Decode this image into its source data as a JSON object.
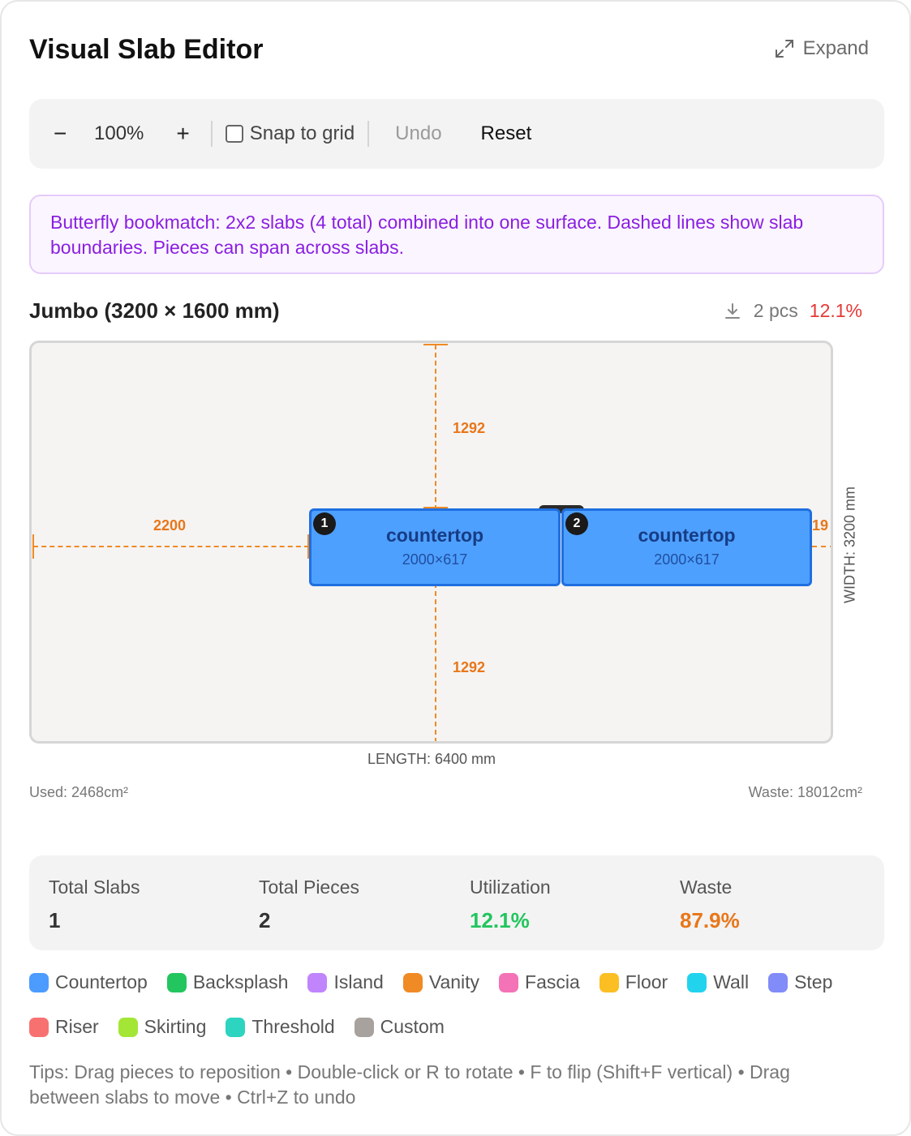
{
  "header": {
    "title": "Visual Slab Editor",
    "expand_label": "Expand",
    "expand_icon": "expand-arrows-icon"
  },
  "toolbar": {
    "zoom_out": "−",
    "zoom_level": "100%",
    "zoom_in": "+",
    "snap_label": "Snap to grid",
    "snap_checked": false,
    "undo_label": "Undo",
    "reset_label": "Reset"
  },
  "info": {
    "text": "Butterfly bookmatch: 2x2 slabs (4 total) combined into one surface. Dashed lines show slab boundaries. Pieces can span across slabs."
  },
  "slab": {
    "name": "Jumbo (3200 × 1600 mm)",
    "download_icon": "download-icon",
    "pieces_count": "2 pcs",
    "utilization": "12.1%",
    "dims": {
      "top": "1292",
      "bottom": "1292",
      "left": "2200",
      "right": "19"
    },
    "pieces": [
      {
        "number": "1",
        "name": "countertop",
        "size": "2000×617"
      },
      {
        "number": "2",
        "name": "countertop",
        "size": "2000×617"
      }
    ],
    "length_label": "LENGTH: 6400 mm",
    "width_label": "WIDTH: 3200 mm",
    "used": "Used: 2468cm²",
    "waste": "Waste: 18012cm²"
  },
  "stats": [
    {
      "label": "Total Slabs",
      "value": "1"
    },
    {
      "label": "Total Pieces",
      "value": "2"
    },
    {
      "label": "Utilization",
      "value": "12.1%"
    },
    {
      "label": "Waste",
      "value": "87.9%"
    }
  ],
  "legend": [
    {
      "label": "Countertop",
      "color": "#4c9bff"
    },
    {
      "label": "Backsplash",
      "color": "#22c55e"
    },
    {
      "label": "Island",
      "color": "#c084fc"
    },
    {
      "label": "Vanity",
      "color": "#f08a24"
    },
    {
      "label": "Fascia",
      "color": "#f472b6"
    },
    {
      "label": "Floor",
      "color": "#fbbf24"
    },
    {
      "label": "Wall",
      "color": "#22d3ee"
    },
    {
      "label": "Step",
      "color": "#818cf8"
    },
    {
      "label": "Riser",
      "color": "#f87171"
    },
    {
      "label": "Skirting",
      "color": "#a3e635"
    },
    {
      "label": "Threshold",
      "color": "#2dd4bf"
    },
    {
      "label": "Custom",
      "color": "#a8a29e"
    }
  ],
  "tips": "Tips: Drag pieces to reposition • Double-click or R to rotate • F to flip (Shift+F vertical) • Drag between slabs to move • Ctrl+Z to undo"
}
